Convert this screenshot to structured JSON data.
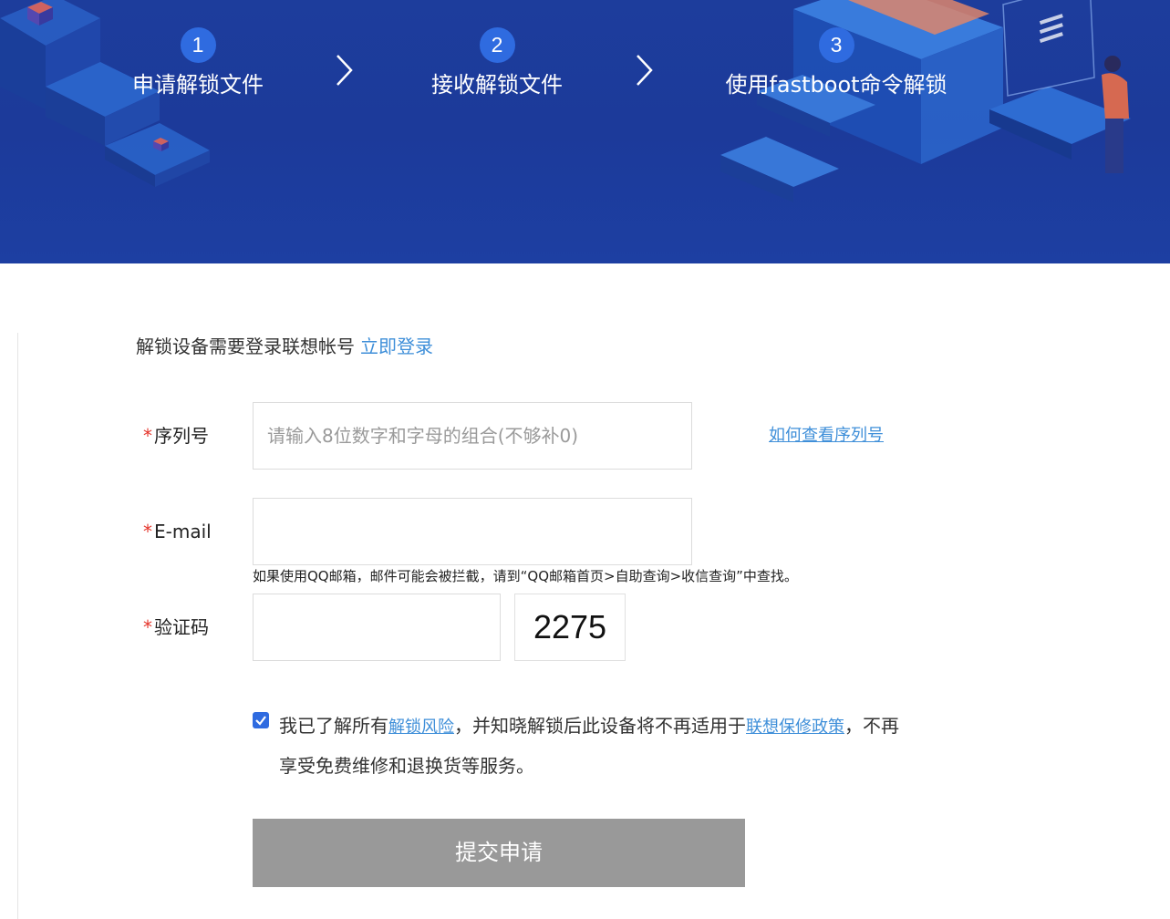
{
  "steps": [
    {
      "num": "1",
      "label": "申请解锁文件"
    },
    {
      "num": "2",
      "label": "接收解锁文件"
    },
    {
      "num": "3",
      "label": "使用fastboot命令解锁"
    }
  ],
  "login": {
    "prompt": "解锁设备需要登录联想帐号",
    "link": "立即登录"
  },
  "form": {
    "required_mark": "*",
    "serial": {
      "label": "序列号",
      "value": "",
      "placeholder": "请输入8位数字和字母的组合(不够补0)",
      "help_link": "如何查看序列号"
    },
    "email": {
      "label": "E-mail",
      "value": "",
      "note": "如果使用QQ邮箱，邮件可能会被拦截，请到“QQ邮箱首页>自助查询>收信查询”中查找。"
    },
    "captcha": {
      "label": "验证码",
      "value": "",
      "code": "2275"
    },
    "agreement": {
      "checked": true,
      "text_1": "我已了解所有",
      "link_1": "解锁风险",
      "text_2": "，并知晓解锁后此设备将不再适用于",
      "link_2": "联想保修政策",
      "text_3": "，不再享受免费维修和退换货等服务。"
    },
    "submit_label": "提交申请"
  },
  "colors": {
    "banner": "#1d3d9c",
    "step_circle": "#2f6be0",
    "link": "#3f8fd9",
    "required": "#e5352b",
    "checkbox": "#2f6be0",
    "submit_disabled": "#999999"
  }
}
